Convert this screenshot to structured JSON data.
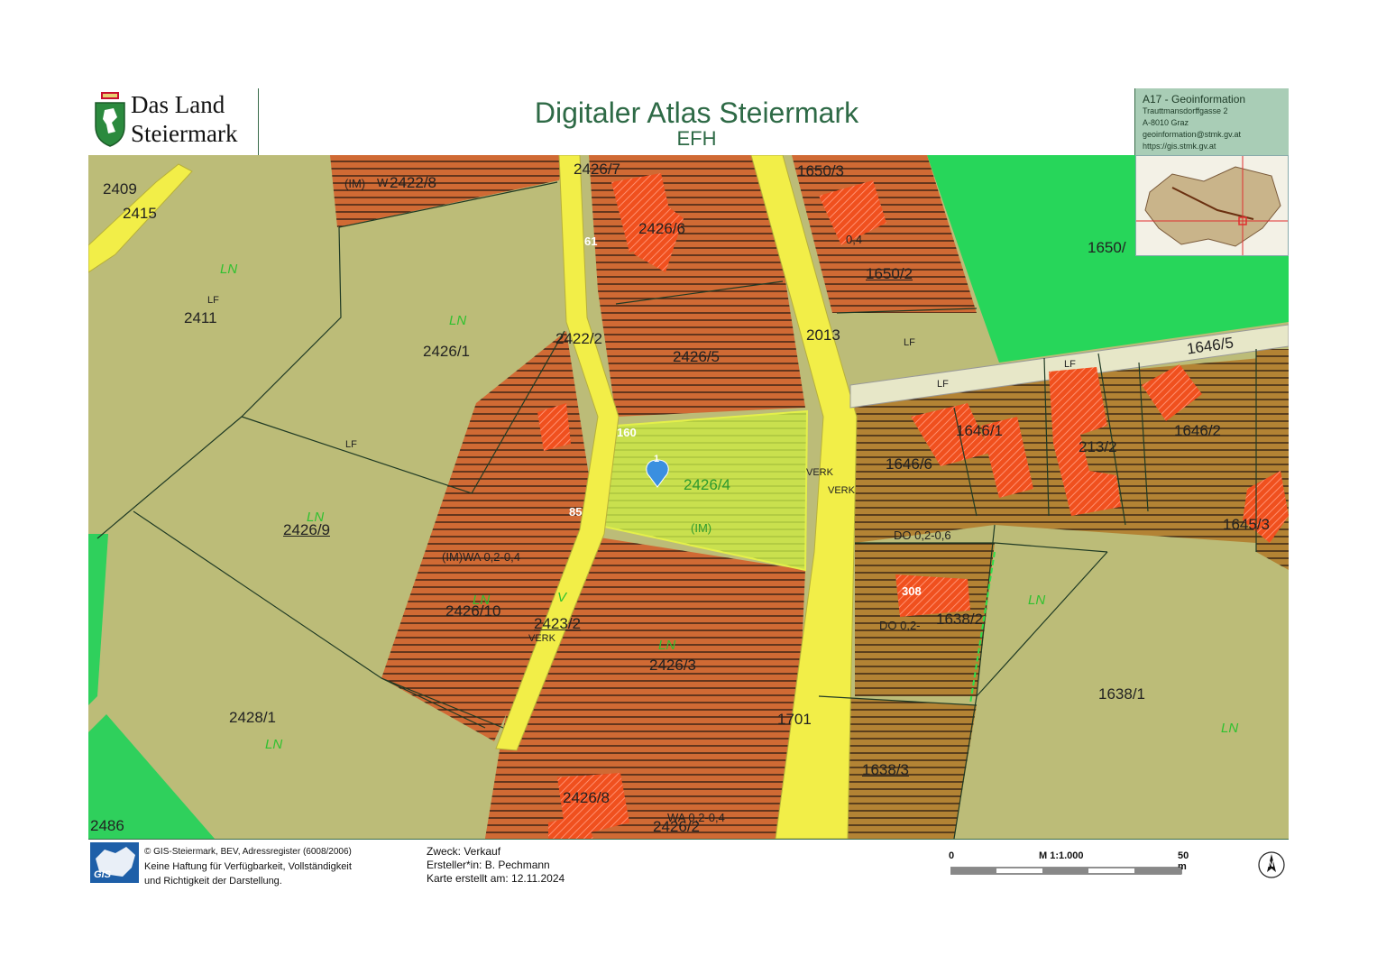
{
  "header": {
    "logo_line1": "Das Land",
    "logo_line2": "Steiermark",
    "title": "Digitaler Atlas Steiermark",
    "subtitle": "EFH",
    "agency": "A17 - Geoinformation",
    "address1": "Trauttmansdorffgasse 2",
    "address2": "A-8010 Graz",
    "email": "geoinformation@stmk.gv.at",
    "url": "https://gis.stmk.gv.at"
  },
  "map": {
    "marker_label": "1",
    "parcels": [
      "2409",
      "2415",
      "2411",
      "2426/1",
      "2426/9",
      "2428/1",
      "2486",
      "2422/2",
      "2426/10",
      "2423/2",
      "2426/7",
      "2426/6",
      "2426/5",
      "2426/4",
      "2426/3",
      "2426/8",
      "2426/2",
      "2422/8",
      "2013",
      "1701",
      "1650/3",
      "1650/2",
      "1650/",
      "1646/5",
      "1646/1",
      "1646/6",
      "1646/2",
      "213/2",
      "1645/3",
      "1638/2",
      "1638/1",
      "1638/3"
    ],
    "zoning": [
      "(IM)",
      "W",
      "WA 0,2-0,4",
      "(IM)WA 0,2-0,4",
      "DO 0,2-0,6",
      "DO 0,2-",
      "0,2-0,6",
      "0,4",
      "308",
      "160",
      "61",
      "85",
      "VERK",
      "LF",
      "LN",
      "V"
    ]
  },
  "footer": {
    "gis_logo": "GIS",
    "copyright": "© GIS-Steiermark, BEV, Adressregister (6008/2006)",
    "disclaimer1": "Keine Haftung für Verfügbarkeit, Vollständigkeit",
    "disclaimer2": "und Richtigkeit der Darstellung.",
    "purpose": "Zweck: Verkauf",
    "creator": "Ersteller*in: B. Pechmann",
    "date": "Karte erstellt am: 12.11.2024",
    "scale_zero": "0",
    "scale_ratio": "M 1:1.000",
    "scale_end": "50 m",
    "north_symbol": "N"
  },
  "colors": {
    "frame": "#3a6b4a",
    "agriculture": "#bcbc78",
    "forest": "#27d65a",
    "building_zone": "#d86a30",
    "road": "#f2ee48",
    "selected_parcel": "#c7e44a",
    "label_green": "#2fc12f"
  }
}
